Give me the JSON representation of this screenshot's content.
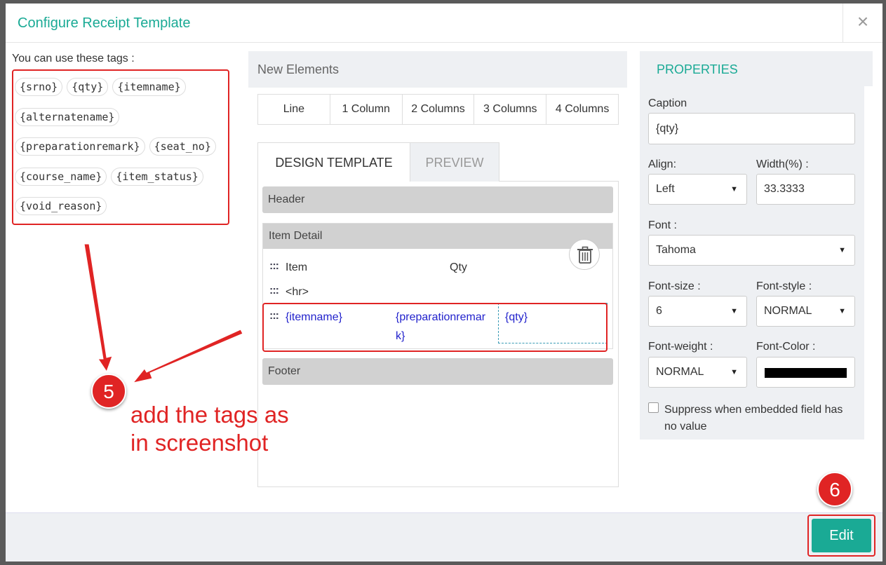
{
  "modal": {
    "title": "Configure Receipt Template",
    "close": "×"
  },
  "tags": {
    "label": "You can use these tags :",
    "rows": [
      [
        "{srno}",
        "{qty}",
        "{itemname}"
      ],
      [
        "{alternatename}"
      ],
      [
        "{preparationremark}",
        "{seat_no}"
      ],
      [
        "{course_name}",
        "{item_status}"
      ],
      [
        "{void_reason}"
      ]
    ]
  },
  "new_elements": {
    "title": "New Elements",
    "columns": [
      "Line",
      "1 Column",
      "2 Columns",
      "3 Columns",
      "4 Columns"
    ]
  },
  "design": {
    "tab_design": "DESIGN TEMPLATE",
    "tab_preview": "PREVIEW",
    "header": "Header",
    "item_detail": "Item Detail",
    "row1": {
      "c1": "Item",
      "c2": "Qty"
    },
    "row2": "<hr>",
    "row3": {
      "c1": "{itemname}",
      "c2a": "{preparationremar",
      "c2b": "k}",
      "c3": "{qty}"
    },
    "footer": "Footer",
    "drag_glyph": ":::"
  },
  "properties": {
    "title": "PROPERTIES",
    "caption_label": "Caption",
    "caption_value": "{qty}",
    "align_label": "Align:",
    "align_value": "Left",
    "width_label": "Width(%) :",
    "width_value": "33.3333",
    "font_label": "Font :",
    "font_value": "Tahoma",
    "fontsize_label": "Font-size :",
    "fontsize_value": "6",
    "fontstyle_label": "Font-style :",
    "fontstyle_value": "NORMAL",
    "fontweight_label": "Font-weight :",
    "fontweight_value": "NORMAL",
    "fontcolor_label": "Font-Color :",
    "fontcolor_value": "#000000",
    "suppress_label": "Suppress when embedded field has no value",
    "suppress_checked": false
  },
  "footer": {
    "edit_label": "Edit"
  },
  "annotations": {
    "badge5": "5",
    "badge6": "6",
    "text_line1": "add the tags as",
    "text_line2": "in screenshot"
  },
  "colors": {
    "accent": "#1aaa95",
    "annotation": "#e02424",
    "tag_blue": "#2222cc"
  }
}
